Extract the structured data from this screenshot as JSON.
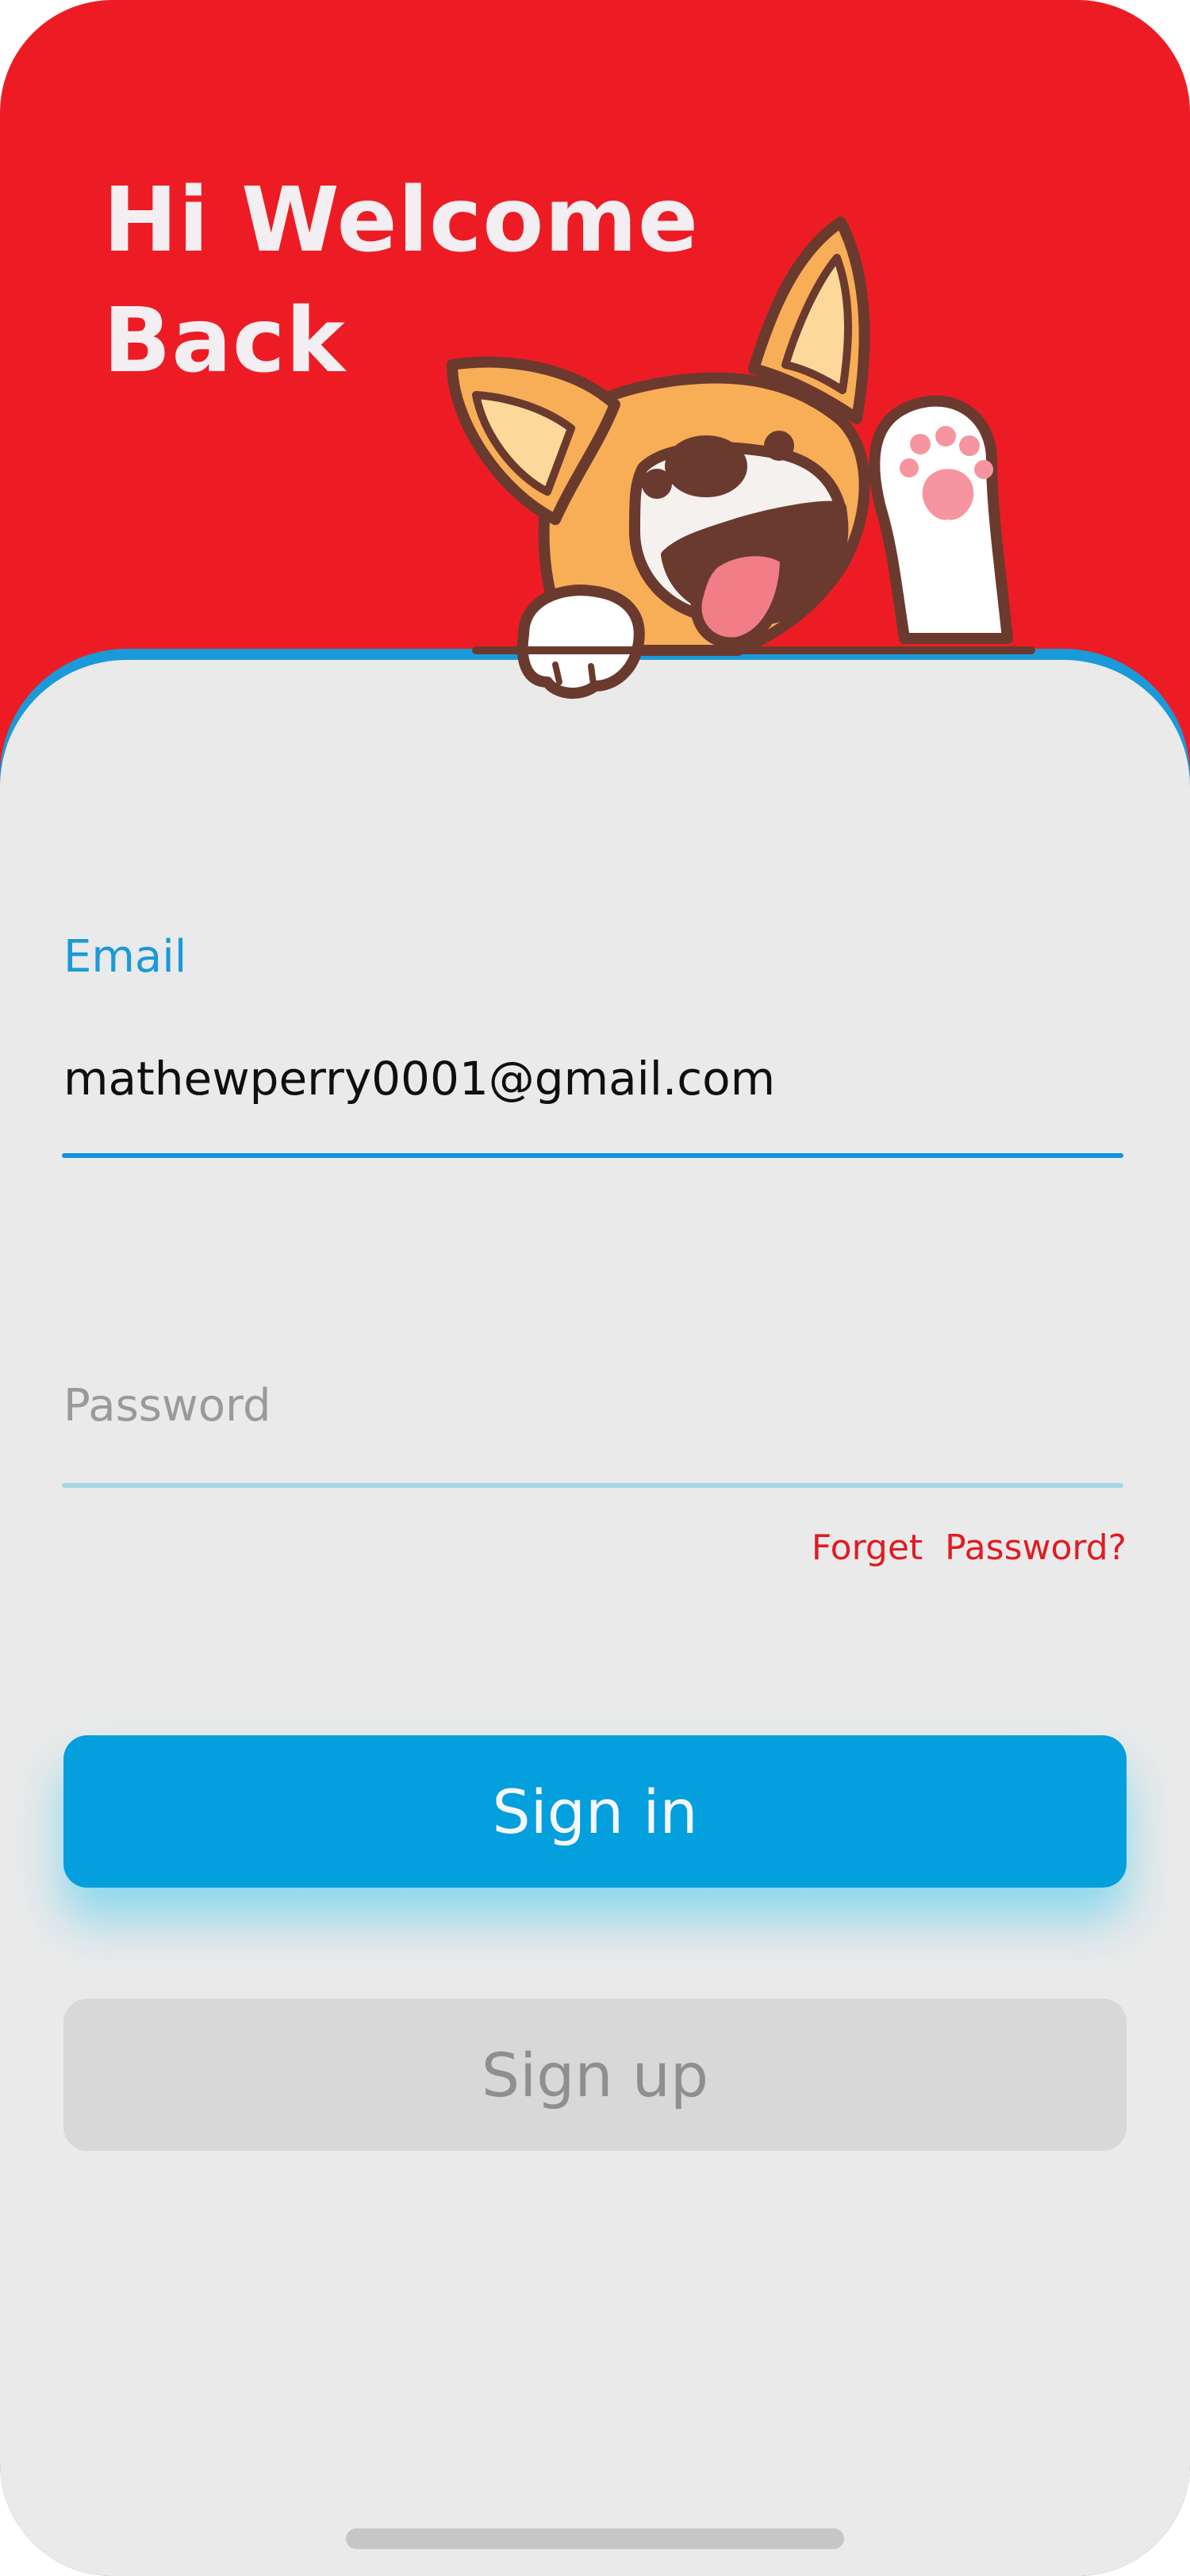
{
  "header": {
    "title_line1": "Hi Welcome",
    "title_line2": "Back"
  },
  "illustration": {
    "name": "corgi-waving-illustration"
  },
  "form": {
    "email_label": "Email",
    "email_value": "mathewperry0001@gmail.com",
    "password_placeholder": "Password",
    "forgot_link": "Forget  Password?"
  },
  "buttons": {
    "signin_label": "Sign in",
    "signup_label": "Sign up"
  },
  "colors": {
    "header_background": "#ed1c24",
    "accent": "#049fdd",
    "sheet_background": "#eaeaea",
    "link": "#e11b22",
    "secondary_button": "#d8d8d8"
  }
}
